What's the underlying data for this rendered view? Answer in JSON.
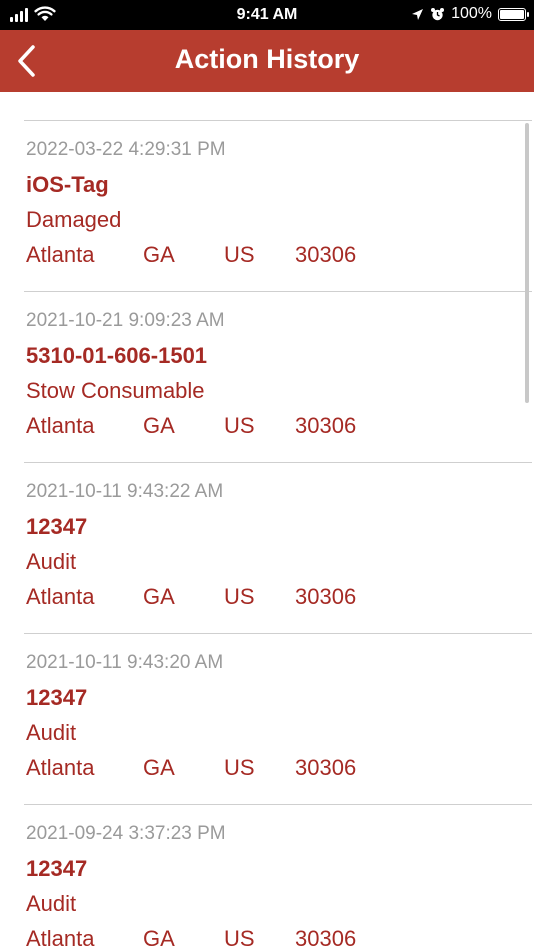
{
  "status_bar": {
    "time": "9:41 AM",
    "battery": "100%",
    "battery_level": 1.0
  },
  "nav": {
    "title": "Action History",
    "color": "#b73d2f"
  },
  "history": [
    {
      "timestamp": "2022-03-22 4:29:31 PM",
      "tag": "iOS-Tag",
      "action": "Damaged",
      "city": "Atlanta",
      "state": "GA",
      "country": "US",
      "zip": "30306"
    },
    {
      "timestamp": "2021-10-21 9:09:23 AM",
      "tag": "5310-01-606-1501",
      "action": "Stow Consumable",
      "city": "Atlanta",
      "state": "GA",
      "country": "US",
      "zip": "30306"
    },
    {
      "timestamp": "2021-10-11 9:43:22 AM",
      "tag": "12347",
      "action": "Audit",
      "city": "Atlanta",
      "state": "GA",
      "country": "US",
      "zip": "30306"
    },
    {
      "timestamp": "2021-10-11 9:43:20 AM",
      "tag": "12347",
      "action": "Audit",
      "city": "Atlanta",
      "state": "GA",
      "country": "US",
      "zip": "30306"
    },
    {
      "timestamp": "2021-09-24 3:37:23 PM",
      "tag": "12347",
      "action": "Audit",
      "city": "Atlanta",
      "state": "GA",
      "country": "US",
      "zip": "30306"
    }
  ]
}
